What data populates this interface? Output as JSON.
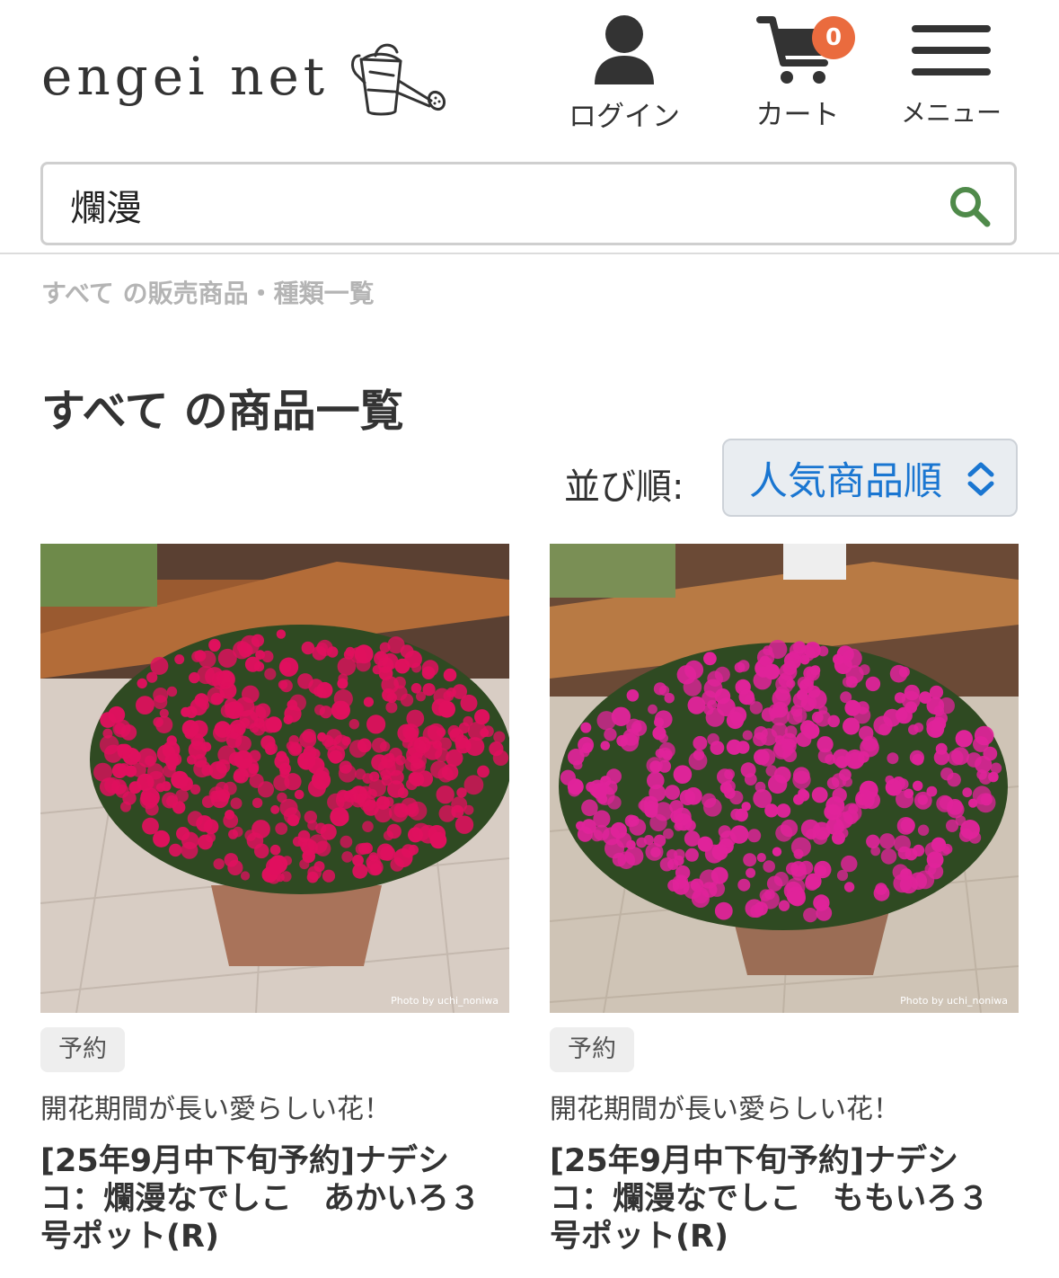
{
  "header": {
    "logo_text": "engei net",
    "login_label": "ログイン",
    "cart_label": "カート",
    "cart_count": "0",
    "menu_label": "メニュー"
  },
  "search": {
    "value": "爛漫"
  },
  "breadcrumb": "すべて の販売商品・種類一覧",
  "page_title": "すべて の商品一覧",
  "sort": {
    "label": "並び順:",
    "selected": "人気商品順"
  },
  "products": [
    {
      "tag": "予約",
      "catch": "開花期間が長い愛らしい花！",
      "name": "[25年9月中下旬予約]ナデシコ：爛漫なでしこ　あかいろ３号ポット(R)",
      "photo_credit": "Photo by uchi_noniwa",
      "flower_color": "#e0105e"
    },
    {
      "tag": "予約",
      "catch": "開花期間が長い愛らしい花！",
      "name": "[25年9月中下旬予約]ナデシコ：爛漫なでしこ　ももいろ３号ポット(R)",
      "photo_credit": "Photo by uchi_noniwa",
      "flower_color": "#e0239a"
    }
  ],
  "colors": {
    "accent": "#1a76d1",
    "badge": "#ea6b3e",
    "search_icon": "#4f8a4a"
  }
}
